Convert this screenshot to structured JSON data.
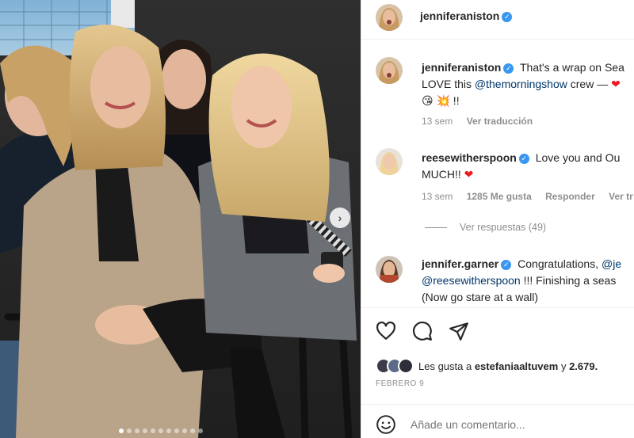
{
  "post": {
    "author": "jenniferaniston",
    "verified": true,
    "date": "FEBRERO 9",
    "likes_prefix": "Les gusta a ",
    "likes_user": "estefaniaaltuvem",
    "likes_connector": " y ",
    "likes_count": "2.679.",
    "carousel": {
      "slide_count": 11,
      "active_index": 0
    }
  },
  "comments": [
    {
      "username": "jenniferaniston",
      "line1": "That's a wrap on Sea",
      "line2_prefix": "LOVE this ",
      "line2_mention": "@themorningshow",
      "line2_suffix": " crew — ",
      "line2_emoji": "❤",
      "line3": "😘 💥 !!",
      "time": "13 sem",
      "translate": "Ver traducción"
    },
    {
      "username": "reesewitherspoon",
      "line1": "Love you and Ou",
      "line2": "MUCH!! ",
      "line2_emoji": "❤",
      "time": "13 sem",
      "likes": "1285 Me gusta",
      "reply": "Responder",
      "translate": "Ver tr"
    },
    {
      "username": "jennifer.garner",
      "line1_prefix": "Congratulations, ",
      "line1_mention": "@je",
      "line2_mention": "@reesewitherspoon",
      "line2_suffix": " !!! Finishing a seas",
      "line3": "(Now go stare at a wall)"
    }
  ],
  "replies_label": "Ver respuestas (49)",
  "add_comment_placeholder": "Añade un comentario...",
  "icons": {
    "like": "heart-icon",
    "comment": "comment-icon",
    "share": "send-icon",
    "emoji": "emoji-icon",
    "next": "chevron-right-icon",
    "verified": "verified-badge-icon"
  },
  "colors": {
    "verified": "#3897f0",
    "mention": "#00376b",
    "heart": "#ed1c24",
    "muted": "#8e8e8e"
  }
}
